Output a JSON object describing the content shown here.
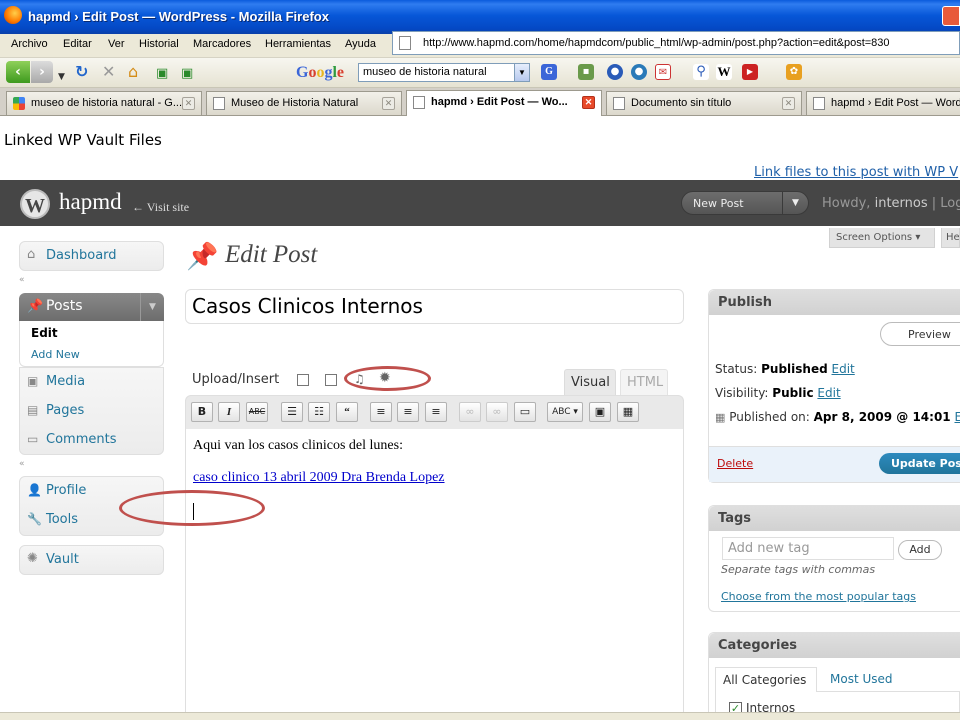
{
  "window": {
    "title": "hapmd › Edit Post — WordPress - Mozilla Firefox"
  },
  "menubar": {
    "items": [
      "Archivo",
      "Editar",
      "Ver",
      "Historial",
      "Marcadores",
      "Herramientas",
      "Ayuda"
    ]
  },
  "address": {
    "url": "http://www.hapmd.com/home/hapmdcom/public_html/wp-admin/post.php?action=edit&post=830"
  },
  "google_toolbar": {
    "logo": "Google",
    "search_value": "museo de historia natural"
  },
  "tabs": [
    {
      "label": "museo de historia natural - G...",
      "active": false
    },
    {
      "label": "Museo de Historia Natural",
      "active": false
    },
    {
      "label": "hapmd › Edit Post — Wo...",
      "active": true
    },
    {
      "label": "Documento sin título",
      "active": false
    },
    {
      "label": "hapmd › Edit Post — WordP",
      "active": false
    }
  ],
  "page": {
    "vault_title": "Linked WP Vault Files",
    "link_files": "Link files to this post with WP V"
  },
  "wp_header": {
    "logo_letter": "W",
    "site_name": "hapmd",
    "visit_site": "← Visit site",
    "new_post": "New Post",
    "howdy_prefix": "Howdy,",
    "howdy_user": "internos",
    "howdy_suffix": "| Log"
  },
  "screen_tabs": {
    "screen_options": "Screen Options ▾",
    "help": "Help"
  },
  "admin_menu": {
    "dashboard": "Dashboard",
    "posts": "Posts",
    "posts_edit": "Edit",
    "posts_add_new": "Add New",
    "media": "Media",
    "pages": "Pages",
    "comments": "Comments",
    "profile": "Profile",
    "tools": "Tools",
    "vault": "Vault"
  },
  "editor": {
    "heading": "Edit Post",
    "post_title": "Casos Clinicos Internos",
    "upload_insert": "Upload/Insert",
    "visual_tab": "Visual",
    "html_tab": "HTML",
    "body_line": "Aqui van los casos clinicos del lunes:",
    "body_link": "caso clinico 13  abril  2009 Dra Brenda Lopez"
  },
  "publish_box": {
    "title": "Publish",
    "preview": "Preview",
    "status_label": "Status:",
    "status_value": "Published",
    "visibility_label": "Visibility:",
    "visibility_value": "Public",
    "edit": "Edit",
    "published_on_label": "Published on:",
    "published_on_value": "Apr 8, 2009 @ 14:01",
    "published_edit": "Ed",
    "delete": "Delete",
    "update": "Update Pos"
  },
  "tags_box": {
    "title": "Tags",
    "placeholder": "Add new tag",
    "add": "Add",
    "hint": "Separate tags with commas",
    "popular_link": "Choose from the most popular tags"
  },
  "categories_box": {
    "title": "Categories",
    "tab_all": "All Categories",
    "tab_used": "Most Used",
    "category": "Internos"
  },
  "colors": {
    "wp_link": "#21759b",
    "wp_header_bg": "#464646",
    "annotation_red": "#c0504d"
  }
}
